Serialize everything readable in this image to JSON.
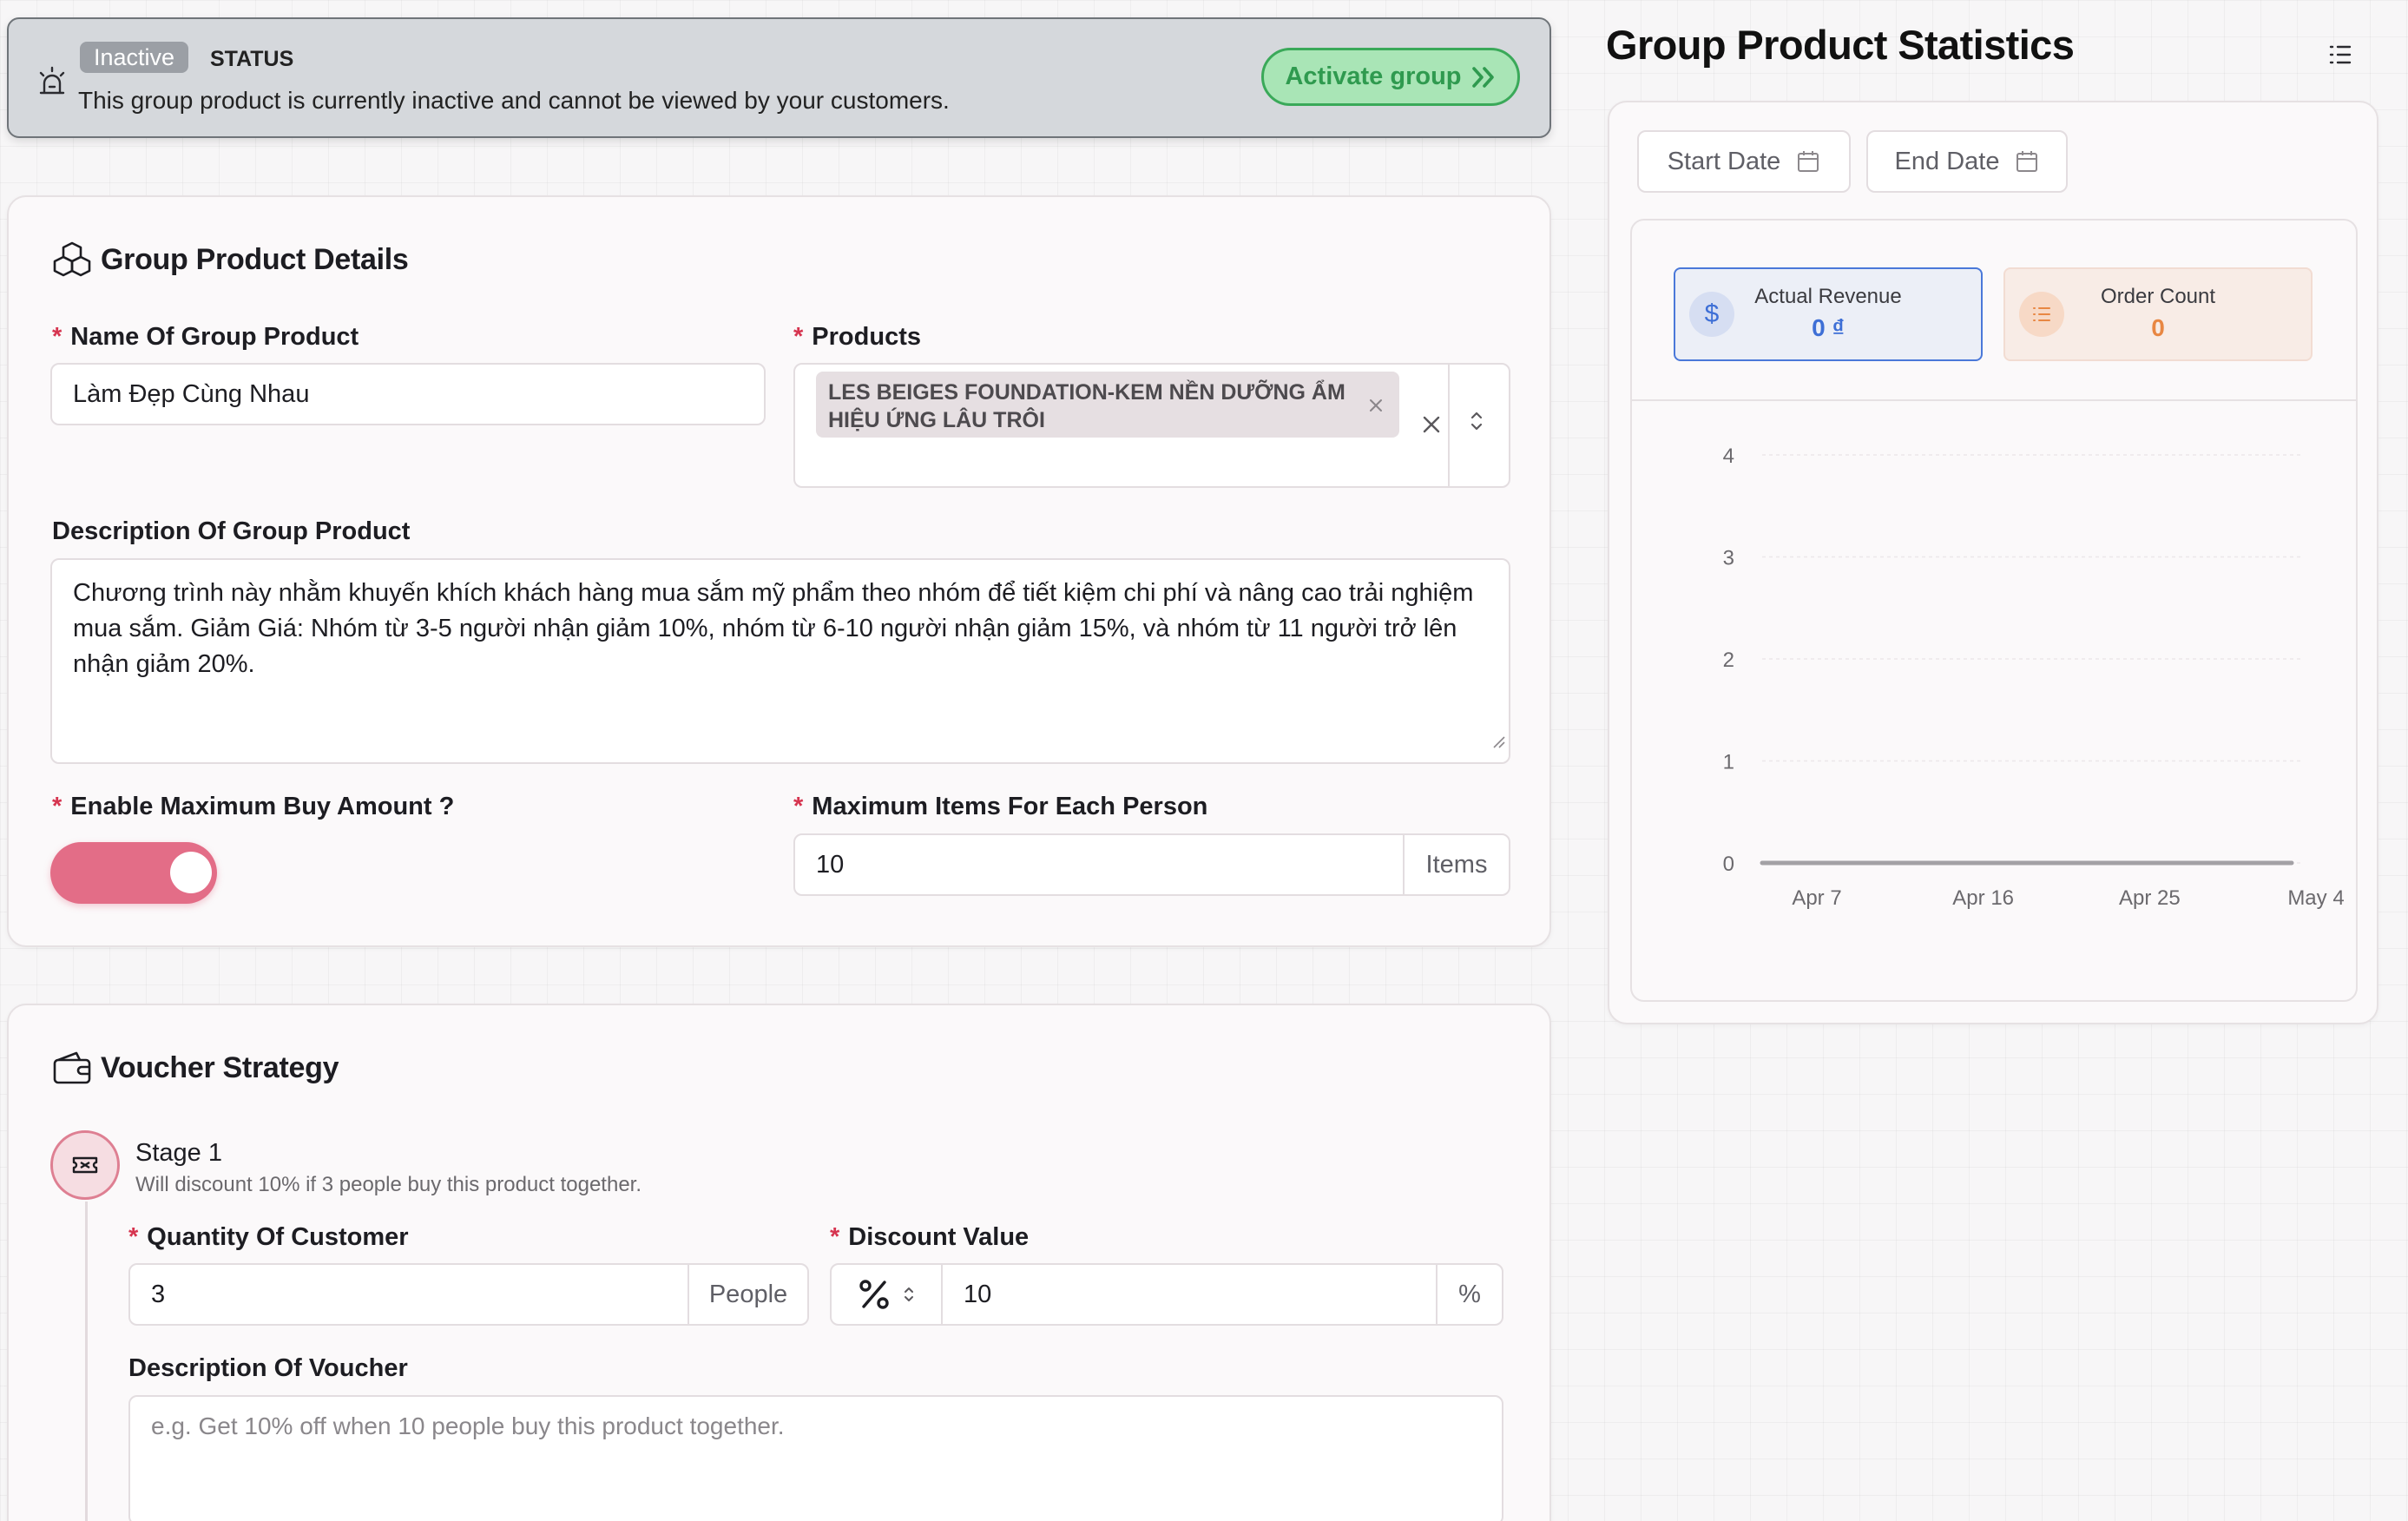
{
  "status_banner": {
    "badge": "Inactive",
    "status_label": "STATUS",
    "message": "This group product is currently inactive and cannot be viewed by your customers.",
    "activate_label": "Activate group"
  },
  "details": {
    "title": "Group Product Details",
    "name_label": "Name Of Group Product",
    "name_value": "Làm Đẹp Cùng Nhau",
    "products_label": "Products",
    "product_tag_line1": "LES BEIGES FOUNDATION-KEM NỀN DƯỠNG ẨM",
    "product_tag_line2": "HIỆU ỨNG LÂU TRÔI",
    "description_label": "Description Of Group Product",
    "description_value": "Chương trình này nhằm khuyến khích khách hàng mua sắm mỹ phẩm theo nhóm để tiết kiệm chi phí và nâng cao trải nghiệm mua sắm. Giảm Giá: Nhóm từ 3-5 người nhận giảm 10%, nhóm từ 6-10 người nhận giảm 15%, và nhóm từ 11 người trở lên nhận giảm 20%.",
    "max_buy_label": "Enable Maximum Buy Amount ?",
    "max_buy_enabled": true,
    "max_items_label": "Maximum Items For Each Person",
    "max_items_value": "10",
    "max_items_unit": "Items"
  },
  "voucher": {
    "title": "Voucher Strategy",
    "stage_title": "Stage 1",
    "stage_desc": "Will discount 10% if 3 people buy this product together.",
    "quantity_label": "Quantity Of Customer",
    "quantity_value": "3",
    "quantity_unit": "People",
    "discount_label": "Discount Value",
    "discount_value": "10",
    "discount_unit": "%",
    "voucher_desc_label": "Description Of Voucher",
    "voucher_desc_placeholder": "e.g. Get 10% off when 10 people buy this product together."
  },
  "stats": {
    "title": "Group Product Statistics",
    "start_date": "Start Date",
    "end_date": "End Date",
    "revenue_label": "Actual Revenue",
    "revenue_value": "0 ₫",
    "order_label": "Order Count",
    "order_value": "0"
  },
  "colors": {
    "accent_pink": "#e36d87",
    "success_green": "#2f9a4f",
    "revenue_blue": "#3e6fd6",
    "order_orange": "#e88743"
  },
  "chart_data": {
    "type": "line",
    "x_ticks": [
      "Apr 7",
      "Apr 16",
      "Apr 25",
      "May 4"
    ],
    "y_ticks": [
      "0",
      "1",
      "2",
      "3",
      "4"
    ],
    "ylim": [
      0,
      4
    ],
    "series": [
      {
        "x": [
          "Apr 7",
          "Apr 16",
          "Apr 25",
          "May 4"
        ],
        "values": [
          0,
          0,
          0,
          0
        ]
      }
    ],
    "grid": true
  }
}
